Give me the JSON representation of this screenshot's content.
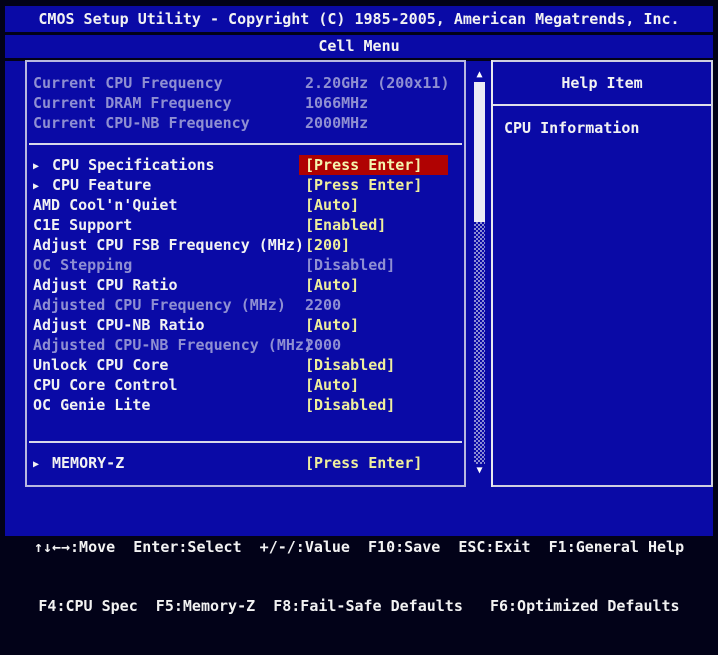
{
  "title_bar": {
    "line1": "CMOS Setup Utility - Copyright (C) 1985-2005, American Megatrends, Inc.",
    "line2": "Cell Menu"
  },
  "menu": {
    "rows": [
      {
        "label": "Current CPU Frequency",
        "value": "2.20GHz (200x11)",
        "state": "info"
      },
      {
        "label": "Current DRAM Frequency",
        "value": "1066MHz",
        "state": "info"
      },
      {
        "label": "Current CPU-NB Frequency",
        "value": "2000MHz",
        "state": "info"
      },
      {
        "label": "CPU Specifications",
        "value": "[Press Enter]",
        "state": "selected",
        "submenu": true
      },
      {
        "label": "CPU Feature",
        "value": "[Press Enter]",
        "state": "normal",
        "submenu": true
      },
      {
        "label": "AMD Cool'n'Quiet",
        "value": "[Auto]",
        "state": "normal"
      },
      {
        "label": "C1E Support",
        "value": "[Enabled]",
        "state": "normal"
      },
      {
        "label": "Adjust CPU FSB Frequency (MHz)",
        "value": "[200]",
        "state": "normal"
      },
      {
        "label": "OC Stepping",
        "value": "[Disabled]",
        "state": "disabled"
      },
      {
        "label": "Adjust CPU Ratio",
        "value": "[Auto]",
        "state": "normal"
      },
      {
        "label": "Adjusted CPU Frequency (MHz)",
        "value": "2200",
        "state": "disabled"
      },
      {
        "label": "Adjust CPU-NB Ratio",
        "value": "[Auto]",
        "state": "normal"
      },
      {
        "label": "Adjusted CPU-NB Frequency (MHz)",
        "value": "2000",
        "state": "disabled"
      },
      {
        "label": "Unlock CPU Core",
        "value": "[Disabled]",
        "state": "normal"
      },
      {
        "label": "CPU Core Control",
        "value": "[Auto]",
        "state": "normal"
      },
      {
        "label": "OC Genie Lite",
        "value": "[Disabled]",
        "state": "normal"
      },
      {
        "label": "MEMORY-Z",
        "value": "[Press Enter]",
        "state": "normal",
        "submenu": true
      }
    ]
  },
  "help_panel": {
    "title": "Help Item",
    "content": "CPU Information"
  },
  "icons": {
    "submenu_arrow": "▶",
    "scroll_up": "▲",
    "scroll_down": "▼"
  },
  "footer": {
    "line1": "↑↓←→:Move  Enter:Select  +/-/:Value  F10:Save  ESC:Exit  F1:General Help",
    "line2": "F4:CPU Spec  F5:Memory-Z  F8:Fail-Safe Defaults   F6:Optimized Defaults"
  },
  "colors": {
    "background_blue": "#0a0aa6",
    "outer_dark": "#020218",
    "text_white": "#f2f2f2",
    "text_disabled": "#8f8fd2",
    "value_yellow": "#efef9c",
    "selected_red": "#b00202",
    "border_light": "#b8b8e0"
  }
}
